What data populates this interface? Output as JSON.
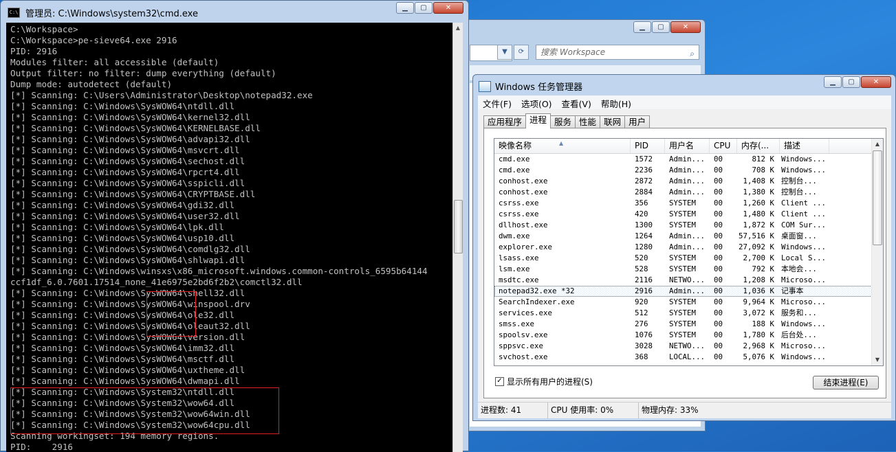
{
  "explorer": {
    "search_placeholder": "搜索 Workspace"
  },
  "cmd": {
    "title": "管理员: C:\\Windows\\system32\\cmd.exe",
    "lines": [
      "C:\\Workspace>",
      "C:\\Workspace>pe-sieve64.exe 2916",
      "PID: 2916",
      "Modules filter: all accessible (default)",
      "Output filter: no filter: dump everything (default)",
      "Dump mode: autodetect (default)",
      "[*] Scanning: C:\\Users\\Administrator\\Desktop\\notepad32.exe",
      "[*] Scanning: C:\\Windows\\SysWOW64\\ntdll.dll",
      "[*] Scanning: C:\\Windows\\SysWOW64\\kernel32.dll",
      "[*] Scanning: C:\\Windows\\SysWOW64\\KERNELBASE.dll",
      "[*] Scanning: C:\\Windows\\SysWOW64\\advapi32.dll",
      "[*] Scanning: C:\\Windows\\SysWOW64\\msvcrt.dll",
      "[*] Scanning: C:\\Windows\\SysWOW64\\sechost.dll",
      "[*] Scanning: C:\\Windows\\SysWOW64\\rpcrt4.dll",
      "[*] Scanning: C:\\Windows\\SysWOW64\\sspicli.dll",
      "[*] Scanning: C:\\Windows\\SysWOW64\\CRYPTBASE.dll",
      "[*] Scanning: C:\\Windows\\SysWOW64\\gdi32.dll",
      "[*] Scanning: C:\\Windows\\SysWOW64\\user32.dll",
      "[*] Scanning: C:\\Windows\\SysWOW64\\lpk.dll",
      "[*] Scanning: C:\\Windows\\SysWOW64\\usp10.dll",
      "[*] Scanning: C:\\Windows\\SysWOW64\\comdlg32.dll",
      "[*] Scanning: C:\\Windows\\SysWOW64\\shlwapi.dll",
      "[*] Scanning: C:\\Windows\\winsxs\\x86_microsoft.windows.common-controls_6595b64144",
      "ccf1df_6.0.7601.17514_none_41e6975e2bd6f2b2\\comctl32.dll",
      "[*] Scanning: C:\\Windows\\SysWOW64\\shell32.dll",
      "[*] Scanning: C:\\Windows\\SysWOW64\\winspool.drv",
      "[*] Scanning: C:\\Windows\\SysWOW64\\ole32.dll",
      "[*] Scanning: C:\\Windows\\SysWOW64\\oleaut32.dll",
      "[*] Scanning: C:\\Windows\\SysWOW64\\version.dll",
      "[*] Scanning: C:\\Windows\\SysWOW64\\imm32.dll",
      "[*] Scanning: C:\\Windows\\SysWOW64\\msctf.dll",
      "[*] Scanning: C:\\Windows\\SysWOW64\\uxtheme.dll",
      "[*] Scanning: C:\\Windows\\SysWOW64\\dwmapi.dll",
      "[*] Scanning: C:\\Windows\\System32\\ntdll.dll",
      "[*] Scanning: C:\\Windows\\System32\\wow64.dll",
      "[*] Scanning: C:\\Windows\\System32\\wow64win.dll",
      "[*] Scanning: C:\\Windows\\System32\\wow64cpu.dll",
      "Scanning workingset: 194 memory regions.",
      "PID:    2916"
    ]
  },
  "taskmgr": {
    "title": "Windows 任务管理器",
    "menu": [
      "文件(F)",
      "选项(O)",
      "查看(V)",
      "帮助(H)"
    ],
    "tabs": [
      "应用程序",
      "进程",
      "服务",
      "性能",
      "联网",
      "用户"
    ],
    "active_tab": 1,
    "columns": [
      "映像名称",
      "PID",
      "用户名",
      "CPU",
      "内存(...",
      "描述"
    ],
    "rows": [
      [
        "cmd.exe",
        "1572",
        "Admin...",
        "00",
        "812 K",
        "Windows..."
      ],
      [
        "cmd.exe",
        "2236",
        "Admin...",
        "00",
        "708 K",
        "Windows..."
      ],
      [
        "conhost.exe",
        "2872",
        "Admin...",
        "00",
        "1,408 K",
        "控制台..."
      ],
      [
        "conhost.exe",
        "2884",
        "Admin...",
        "00",
        "1,380 K",
        "控制台..."
      ],
      [
        "csrss.exe",
        "356",
        "SYSTEM",
        "00",
        "1,260 K",
        "Client ..."
      ],
      [
        "csrss.exe",
        "420",
        "SYSTEM",
        "00",
        "1,480 K",
        "Client ..."
      ],
      [
        "dllhost.exe",
        "1300",
        "SYSTEM",
        "00",
        "1,872 K",
        "COM Sur..."
      ],
      [
        "dwm.exe",
        "1264",
        "Admin...",
        "00",
        "57,516 K",
        "桌面窗..."
      ],
      [
        "explorer.exe",
        "1280",
        "Admin...",
        "00",
        "27,092 K",
        "Windows..."
      ],
      [
        "lsass.exe",
        "520",
        "SYSTEM",
        "00",
        "2,700 K",
        "Local S..."
      ],
      [
        "lsm.exe",
        "528",
        "SYSTEM",
        "00",
        "792 K",
        "本地会..."
      ],
      [
        "msdtc.exe",
        "2116",
        "NETWO...",
        "00",
        "1,208 K",
        "Microso..."
      ],
      [
        "notepad32.exe *32",
        "2916",
        "Admin...",
        "00",
        "1,036 K",
        "记事本"
      ],
      [
        "SearchIndexer.exe",
        "920",
        "SYSTEM",
        "00",
        "9,964 K",
        "Microso..."
      ],
      [
        "services.exe",
        "512",
        "SYSTEM",
        "00",
        "3,072 K",
        "服务和..."
      ],
      [
        "smss.exe",
        "276",
        "SYSTEM",
        "00",
        "188 K",
        "Windows..."
      ],
      [
        "spoolsv.exe",
        "1076",
        "SYSTEM",
        "00",
        "1,780 K",
        "后台处..."
      ],
      [
        "sppsvc.exe",
        "3028",
        "NETWO...",
        "00",
        "2,968 K",
        "Microso..."
      ],
      [
        "svchost.exe",
        "368",
        "LOCAL...",
        "00",
        "5,076 K",
        "Windows..."
      ]
    ],
    "selected_row": 12,
    "show_all_label": "显示所有用户的进程(S)",
    "end_process_label": "结束进程(E)",
    "status": [
      "进程数: 41",
      "CPU 使用率: 0%",
      "物理内存: 33%"
    ]
  }
}
